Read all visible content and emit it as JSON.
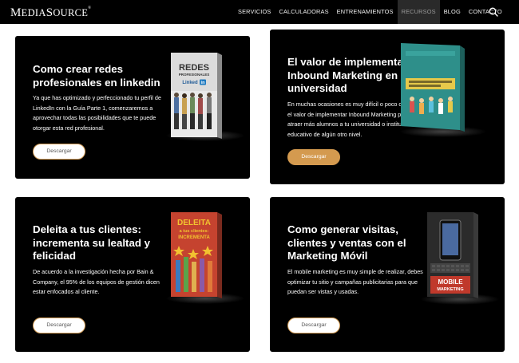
{
  "header": {
    "logo_big": "M",
    "logo_rest": "EDIA",
    "logo_big2": "S",
    "logo_rest2": "OURCE",
    "logo_mark": "®",
    "nav": [
      "SERVICIOS",
      "CALCULADORAS",
      "ENTRENAMIENTOS",
      "RECURSOS",
      "BLOG",
      "CONTACTO"
    ],
    "active_nav": "RECURSOS"
  },
  "cards": [
    {
      "title": "Como crear redes profesionales en linkedin",
      "description": "Ya que has optimizado y perfeccionado tu perfil de LinkedIn con la Guía Parte 1, comenzaremos a aprovechar todas las posibilidades que te puede otorgar esta red profesional.",
      "button": "Descargar",
      "book_lines": [
        "REDES",
        "PROFESIONALES",
        "Linked",
        "in"
      ]
    },
    {
      "title": "El valor de implementar Inbound Marketing en tu universidad",
      "description": "En muchas ocasiones es muy difícil o poco claro ver el valor de implementar Inbound Marketing para atraer más alumnos a tu universidad o institución educativo de algún otro nivel.",
      "button": "Descargar"
    },
    {
      "title": "Deleita a tus clientes: incrementa su lealtad y felicidad",
      "description": "De acuerdo a la investigación hecha por Bain & Company, el 95% de los equipos de gestión dicen estar enfocados al cliente.",
      "button": "Descargar",
      "book_lines": [
        "DELEITA",
        "a tus clientes:",
        "INCREMENTA"
      ]
    },
    {
      "title": "Como generar visitas, clientes y ventas con el Marketing Móvil",
      "description": "El mobile marketing es muy simple de realizar, debes optimizar tu sitio y campañas publicitarias para que puedan ser vistas y usadas.",
      "button": "Descargar",
      "book_lines": [
        "MOBILE",
        "MARKETING"
      ]
    }
  ],
  "colors": {
    "accent": "#d49a4f",
    "card_bg": "#000000",
    "header_bg": "#000000"
  }
}
